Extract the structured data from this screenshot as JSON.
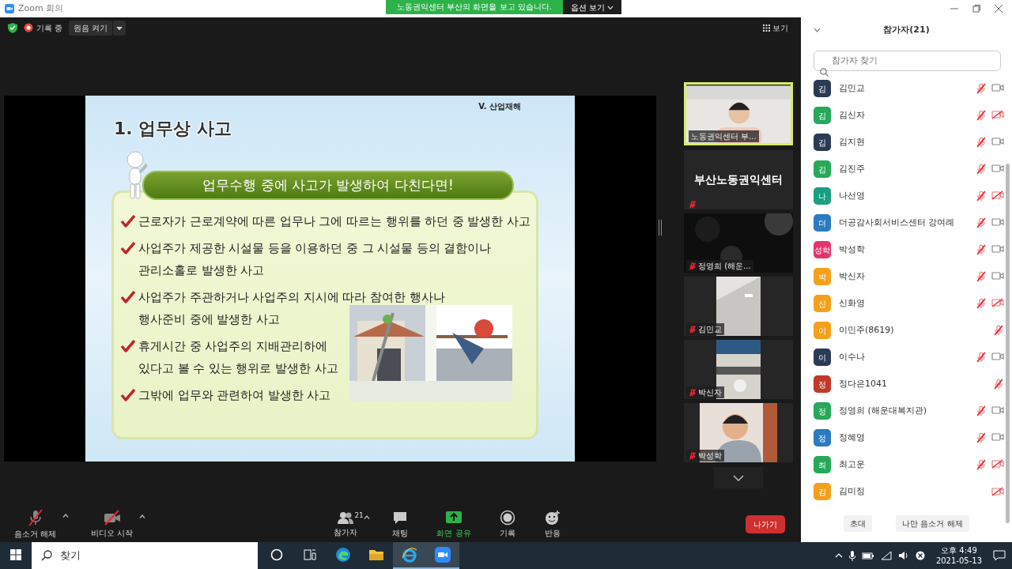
{
  "window": {
    "title": "Zoom 회의"
  },
  "share_banner": {
    "text": "노동권익센터 부산의 화면을 보고 있습니다.",
    "options": "옵션 보기"
  },
  "top_bar": {
    "recording": "기록 중",
    "original_sound": "원음 켜기",
    "view": "보기"
  },
  "slide": {
    "section": "V. 산업재해",
    "title": "1. 업무상 사고",
    "banner": "업무수행 중에 사고가 발생하여 다친다면!",
    "bullets": [
      {
        "lines": [
          "근로자가 근로계약에 따른 업무나 그에 따르는 행위를 하던 중 발생한 사고"
        ]
      },
      {
        "lines": [
          "사업주가 제공한 시설물 등을 이용하던 중 그 시설물 등의 결함이나",
          "관리소홀로 발생한 사고"
        ]
      },
      {
        "lines": [
          "사업주가 주관하거나 사업주의 지시에 따라 참여한 행사나",
          "행사준비 중에 발생한 사고"
        ]
      },
      {
        "lines": [
          "휴게시간 중 사업주의 지배관리하에",
          "있다고 볼 수 있는 행위로 발생한 사고"
        ]
      },
      {
        "lines": [
          "그밖에 업무와 관련하여 발생한 사고"
        ]
      }
    ]
  },
  "video_tiles": [
    {
      "kind": "video",
      "name": "노동권익센터 부...",
      "active_speaker": true,
      "muted": false
    },
    {
      "kind": "name",
      "name": "부산노동권익센터",
      "active_speaker": false,
      "muted": true
    },
    {
      "kind": "video",
      "name": "정영희 (해운...",
      "active_speaker": false,
      "muted": true
    },
    {
      "kind": "video",
      "name": "김민교",
      "active_speaker": false,
      "muted": true
    },
    {
      "kind": "video",
      "name": "박신자",
      "active_speaker": false,
      "muted": true
    },
    {
      "kind": "video",
      "name": "박성학",
      "active_speaker": false,
      "muted": true
    }
  ],
  "toolbar": [
    {
      "kind": "mic",
      "label": "음소거 해제",
      "muted": true,
      "caret": true
    },
    {
      "kind": "video",
      "label": "비디오 시작",
      "muted": true,
      "caret": true
    },
    {
      "kind": "participants",
      "label": "참가자",
      "count": "21",
      "caret": true
    },
    {
      "kind": "chat",
      "label": "채팅"
    },
    {
      "kind": "share",
      "label": "화면 공유"
    },
    {
      "kind": "record",
      "label": "기록"
    },
    {
      "kind": "reactions",
      "label": "반응"
    }
  ],
  "leave_button": "나가기",
  "panel": {
    "title": "참가자(21)",
    "search": {
      "placeholder": "참가자 찾기"
    },
    "participants": [
      {
        "initial": "김",
        "color": "#2b3a55",
        "name": "김민교",
        "mic_muted": true,
        "camera_on": true
      },
      {
        "initial": "김",
        "color": "#27a85a",
        "name": "김신자",
        "mic_muted": true,
        "camera_on": false
      },
      {
        "initial": "김",
        "color": "#2b3a55",
        "name": "김지현",
        "mic_muted": true,
        "camera_on": true
      },
      {
        "initial": "김",
        "color": "#27a85a",
        "name": "김진주",
        "mic_muted": true,
        "camera_on": true
      },
      {
        "initial": "나",
        "color": "#1a9e82",
        "name": "나선영",
        "mic_muted": true,
        "camera_on": false
      },
      {
        "initial": "더",
        "color": "#2a7bc0",
        "name": "더공감사회서비스센터 강여례",
        "mic_muted": true,
        "camera_on": true
      },
      {
        "initial": "성학",
        "color": "#e8336b",
        "name": "박성학",
        "mic_muted": true,
        "camera_on": true
      },
      {
        "initial": "박",
        "color": "#f5a01a",
        "name": "박신자",
        "mic_muted": true,
        "camera_on": true
      },
      {
        "initial": "신",
        "color": "#f5a01a",
        "name": "신화영",
        "mic_muted": true,
        "camera_on": false
      },
      {
        "initial": "이",
        "color": "#f5a01a",
        "name": "이민주(8619)",
        "mic_muted": true
      },
      {
        "initial": "이",
        "color": "#2b3a55",
        "name": "이수나",
        "mic_muted": true,
        "camera_on": true
      },
      {
        "initial": "정",
        "color": "#c0392b",
        "name": "정다은1041",
        "mic_muted": true
      },
      {
        "initial": "정",
        "color": "#27a85a",
        "name": "정영희 (해운대복지관)",
        "mic_muted": true,
        "camera_on": true
      },
      {
        "initial": "정",
        "color": "#2a7bc0",
        "name": "정혜영",
        "mic_muted": true,
        "camera_on": true
      },
      {
        "initial": "최",
        "color": "#27a85a",
        "name": "최고운",
        "mic_muted": true,
        "camera_on": false
      },
      {
        "initial": "김",
        "color": "#f5a01a",
        "name": "김미정",
        "camera_on": false
      }
    ],
    "buttons": [
      "초대",
      "나만 음소거 해제"
    ]
  },
  "taskbar": {
    "search": "찾기",
    "apps": [
      {
        "kind": "cortana",
        "active": false
      },
      {
        "kind": "taskview",
        "active": false
      },
      {
        "kind": "edge",
        "active": false
      },
      {
        "kind": "explorer",
        "active": false
      },
      {
        "kind": "ie",
        "active": true
      },
      {
        "kind": "zoom",
        "active": true
      }
    ],
    "time": "오후 4:49",
    "date": "2021-05-13"
  }
}
